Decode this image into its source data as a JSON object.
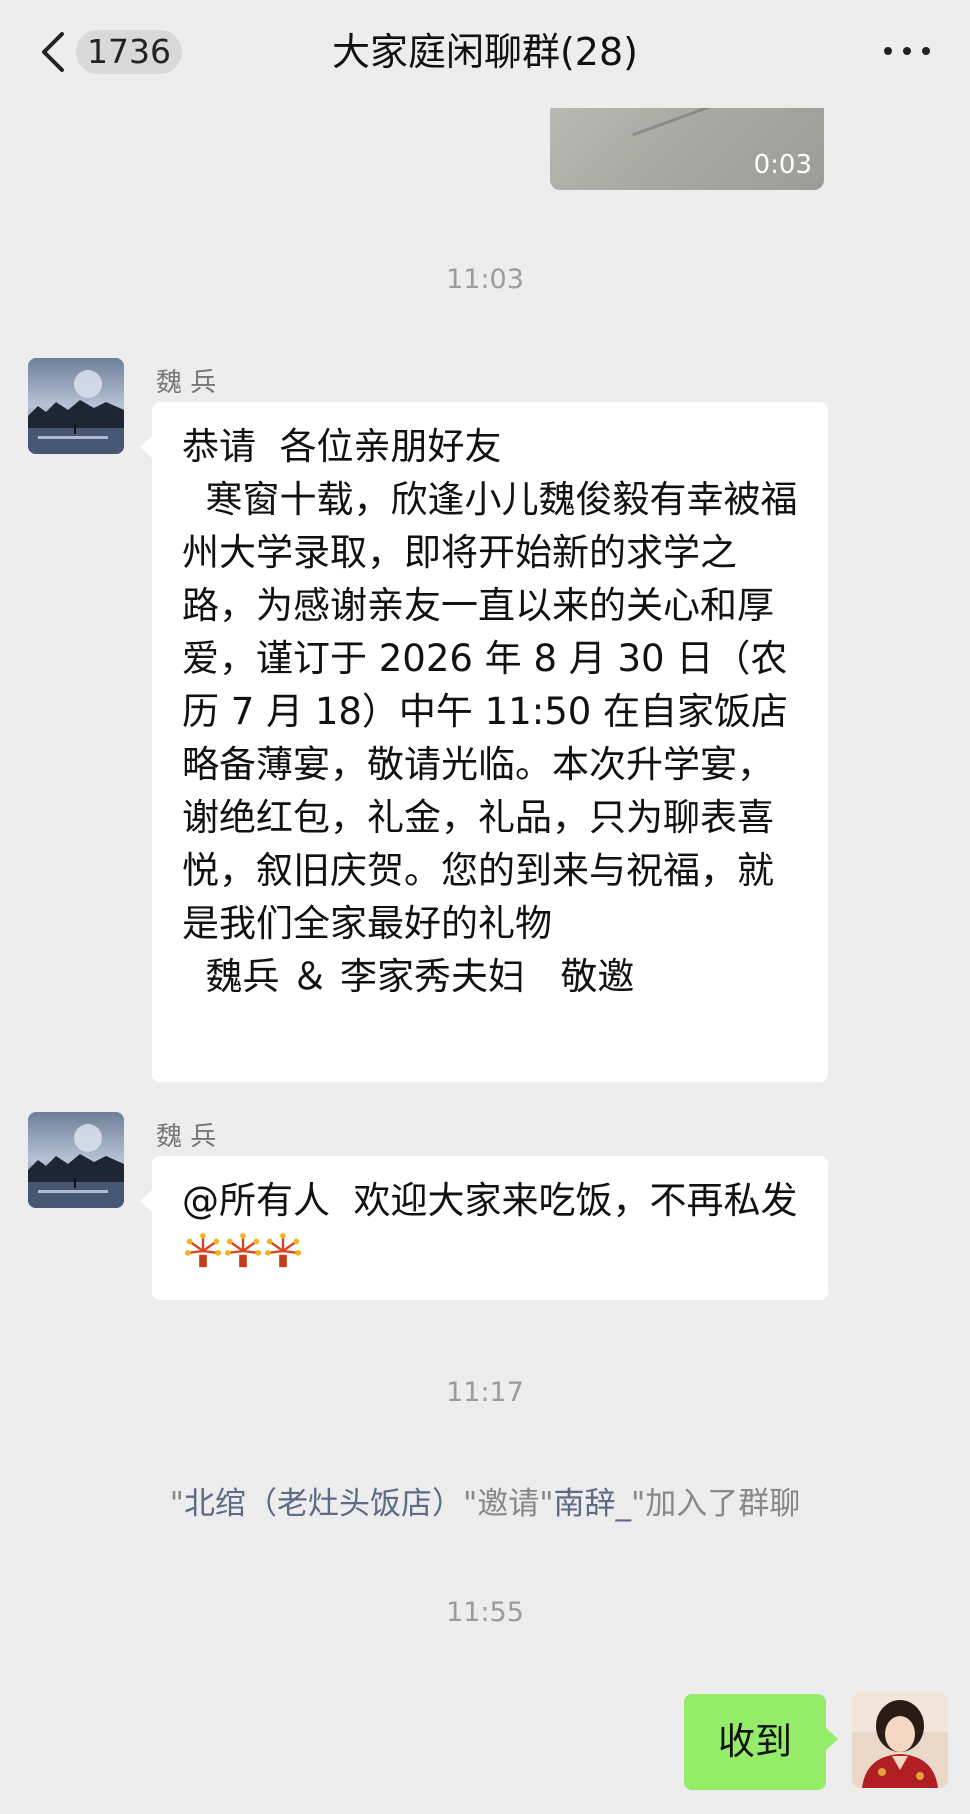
{
  "header": {
    "unread_count": "1736",
    "title": "大家庭闲聊群(28)"
  },
  "video": {
    "duration": "0:03"
  },
  "times": {
    "t1": "11:03",
    "t2": "11:17",
    "t3": "11:55"
  },
  "messages": [
    {
      "sender": "魏 兵",
      "text": "恭请  各位亲朋好友\n  寒窗十载，欣逢小儿魏俊毅有幸被福州大学录取，即将开始新的求学之路，为感谢亲友一直以来的关心和厚爱，谨订于 2026 年 8 月 30 日（农历 7 月 18）中午 11:50 在自家饭店略备薄宴，敬请光临。本次升学宴，谢绝红包，礼金，礼品，只为聊表喜悦，叙旧庆贺。您的到来与祝福，就是我们全家最好的礼物\n  魏兵 ＆ 李家秀夫妇   敬邀"
    },
    {
      "sender": "魏 兵",
      "text": "@所有人  欢迎大家来吃饭，不再私发"
    }
  ],
  "system_notice": {
    "quote1": "\"",
    "inviter": "北绾（老灶头饭店）",
    "quote2": "\"",
    "verb": "邀请",
    "quote3": "\"",
    "invitee": "南辞_",
    "quote4": "\"",
    "tail": "加入了群聊"
  },
  "reply": {
    "text": "收到"
  },
  "colors": {
    "background": "#ededed",
    "bubble_self": "#95ec69",
    "bubble_other": "#ffffff",
    "name_link": "#5d6b86"
  },
  "icons": [
    "back-chevron-icon",
    "more-icon",
    "firework-emoji-icon"
  ]
}
